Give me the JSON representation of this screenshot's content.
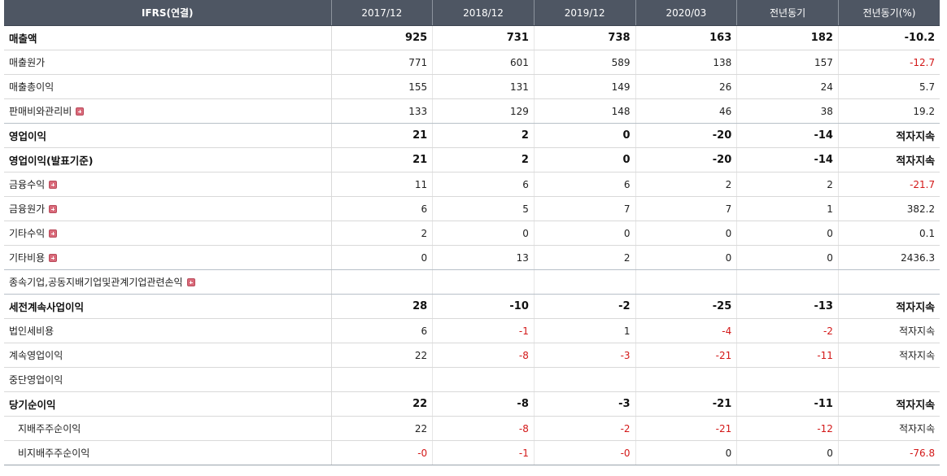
{
  "header": {
    "label": "IFRS(연결)",
    "periods": [
      "2017/12",
      "2018/12",
      "2019/12",
      "2020/03",
      "전년동기",
      "전년동기(%)"
    ]
  },
  "rows": [
    {
      "label": "매출액",
      "bold": true,
      "values": [
        "925",
        "731",
        "738",
        "163",
        "182",
        "-10.2"
      ]
    },
    {
      "label": "매출원가",
      "values": [
        "771",
        "601",
        "589",
        "138",
        "157",
        "-12.7"
      ]
    },
    {
      "label": "매출총이익",
      "values": [
        "155",
        "131",
        "149",
        "26",
        "24",
        "5.7"
      ]
    },
    {
      "label": "판매비와관리비",
      "expand": true,
      "sep": true,
      "values": [
        "133",
        "129",
        "148",
        "46",
        "38",
        "19.2"
      ]
    },
    {
      "label": "영업이익",
      "bold": true,
      "values": [
        "21",
        "2",
        "0",
        "-20",
        "-14",
        "적자지속"
      ]
    },
    {
      "label": "영업이익(발표기준)",
      "bold": true,
      "values": [
        "21",
        "2",
        "0",
        "-20",
        "-14",
        "적자지속"
      ]
    },
    {
      "label": "금융수익",
      "expand": true,
      "values": [
        "11",
        "6",
        "6",
        "2",
        "2",
        "-21.7"
      ]
    },
    {
      "label": "금융원가",
      "expand": true,
      "values": [
        "6",
        "5",
        "7",
        "7",
        "1",
        "382.2"
      ]
    },
    {
      "label": "기타수익",
      "expand": true,
      "values": [
        "2",
        "0",
        "0",
        "0",
        "0",
        "0.1"
      ]
    },
    {
      "label": "기타비용",
      "expand": true,
      "sep": true,
      "values": [
        "0",
        "13",
        "2",
        "0",
        "0",
        "2436.3"
      ]
    },
    {
      "label": "종속기업,공동지배기업및관계기업관련손익",
      "expand": true,
      "sep": true,
      "values": [
        "",
        "",
        "",
        "",
        "",
        ""
      ]
    },
    {
      "label": "세전계속사업이익",
      "bold": true,
      "values": [
        "28",
        "-10",
        "-2",
        "-25",
        "-13",
        "적자지속"
      ]
    },
    {
      "label": "법인세비용",
      "values": [
        "6",
        "-1",
        "1",
        "-4",
        "-2",
        "적자지속"
      ]
    },
    {
      "label": "계속영업이익",
      "values": [
        "22",
        "-8",
        "-3",
        "-21",
        "-11",
        "적자지속"
      ]
    },
    {
      "label": "중단영업이익",
      "values": [
        "",
        "",
        "",
        "",
        "",
        ""
      ]
    },
    {
      "label": "당기순이익",
      "bold": true,
      "values": [
        "22",
        "-8",
        "-3",
        "-21",
        "-11",
        "적자지속"
      ]
    },
    {
      "label": "지배주주순이익",
      "sub": true,
      "values": [
        "22",
        "-8",
        "-2",
        "-21",
        "-12",
        "적자지속"
      ]
    },
    {
      "label": "비지배주주순이익",
      "sub": true,
      "values": [
        "-0",
        "-1",
        "-0",
        "0",
        "0",
        "-76.8"
      ]
    }
  ],
  "colors": {
    "header_bg": "#4e5663",
    "negative": "#d31818",
    "expand_icon": "#d96a7a"
  }
}
